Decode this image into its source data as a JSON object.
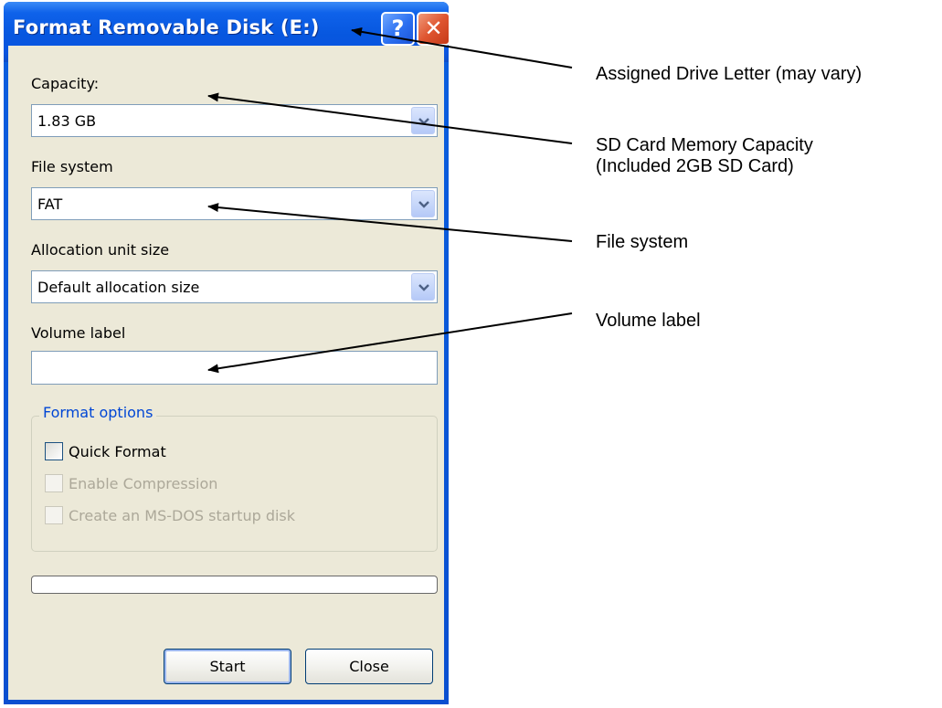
{
  "dialog": {
    "title": "Format Removable Disk (E:)",
    "help_button": "?",
    "close_button": "✕",
    "capacity": {
      "label": "Capacity:",
      "value": "1.83 GB"
    },
    "file_system": {
      "label": "File system",
      "value": "FAT"
    },
    "allocation": {
      "label": "Allocation unit size",
      "value": "Default allocation size"
    },
    "volume_label": {
      "label": "Volume label",
      "value": ""
    },
    "format_options": {
      "legend": "Format options",
      "quick_format": {
        "label": "Quick Format",
        "checked": false,
        "enabled": true
      },
      "enable_compression": {
        "label": "Enable Compression",
        "checked": false,
        "enabled": false
      },
      "msdos_startup": {
        "label": "Create an MS-DOS startup disk",
        "checked": false,
        "enabled": false
      }
    },
    "progress": {
      "value": 0
    },
    "start_button": "Start",
    "close_dialog_button": "Close"
  },
  "annotations": {
    "drive_letter": "Assigned Drive Letter (may vary)",
    "capacity_line1": "SD Card Memory Capacity",
    "capacity_line2": "(Included 2GB SD Card)",
    "file_system": "File system",
    "volume_label": "Volume label"
  },
  "colors": {
    "title_bar": "#0a55e0",
    "dialog_background": "#ece9d8",
    "group_legend": "#0046d5",
    "close_button": "#df5530",
    "disabled_text": "#aca899"
  }
}
